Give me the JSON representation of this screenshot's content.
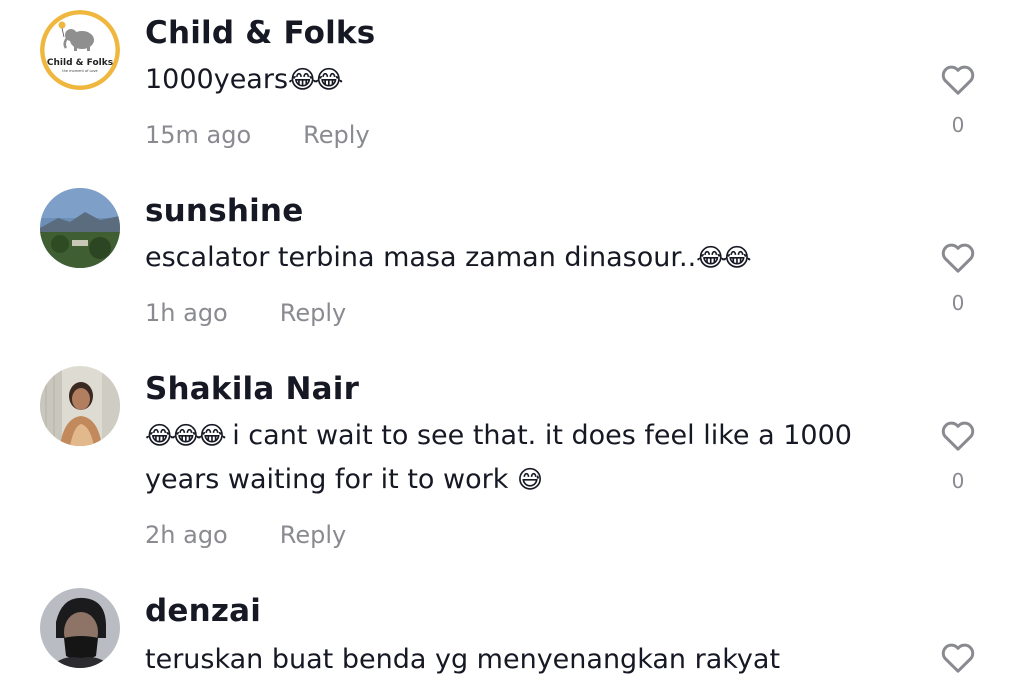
{
  "comments": [
    {
      "username": "Child & Folks",
      "avatar_label": "Child & Folks",
      "avatar_sublabel": "the moment of Love",
      "text": "1000years",
      "emoji": "😂😂",
      "time": "15m ago",
      "reply_label": "Reply",
      "likes": "0"
    },
    {
      "username": "sunshine",
      "text": "escalator terbina masa zaman dinasour..",
      "emoji": "😂😂",
      "time": "1h ago",
      "reply_label": "Reply",
      "likes": "0"
    },
    {
      "username": "Shakila Nair",
      "emoji_lead": "😂😂😂",
      "text": " i cant wait to see that. it does feel like a 1000 years waiting for it to work ",
      "emoji": "😅",
      "time": "2h ago",
      "reply_label": "Reply",
      "likes": "0"
    },
    {
      "username": "denzai",
      "text": "teruskan buat benda yg menyenangkan rakyat"
    }
  ],
  "icons": {
    "like": "heart-outline-icon"
  },
  "colors": {
    "text": "#161823",
    "secondary": "#8a8b91",
    "avatar_ring": "#f0b73e"
  }
}
